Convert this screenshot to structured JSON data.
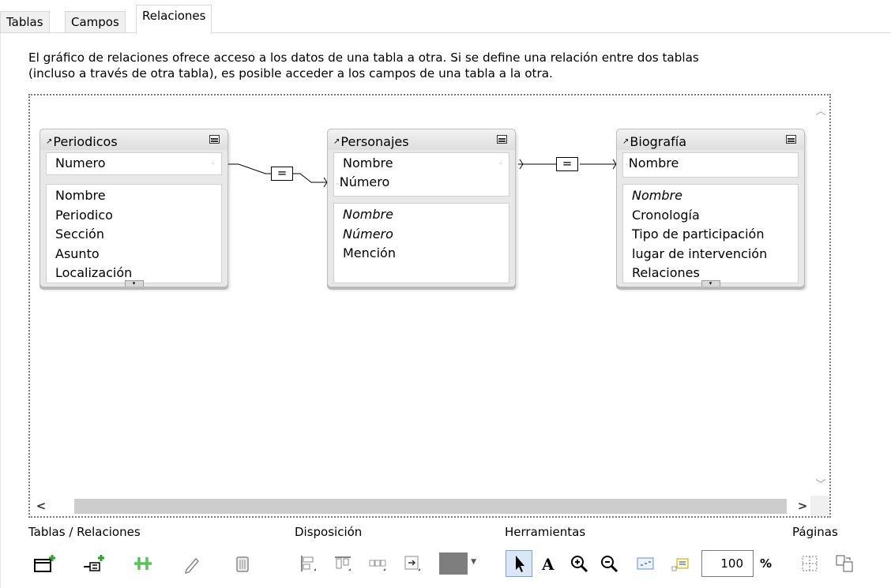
{
  "tabs": [
    {
      "label": "Tablas"
    },
    {
      "label": "Campos"
    },
    {
      "label": "Relaciones"
    }
  ],
  "active_tab": "Relaciones",
  "description": {
    "line1": "El gráfico de relaciones ofrece acceso a los datos de una tabla a otra. Si se define una relación entre dos tablas",
    "line2": "(incluso a través de otra tabla), es posible acceder a los campos de una tabla a la otra."
  },
  "tables": [
    {
      "name": "Periodicos",
      "key_fields": [
        "Numero"
      ],
      "fields": [
        {
          "text": "Nombre",
          "italic": false
        },
        {
          "text": "Periodico",
          "italic": false
        },
        {
          "text": "Sección",
          "italic": false
        },
        {
          "text": "Asunto",
          "italic": false
        },
        {
          "text": "Localización",
          "italic": false
        }
      ]
    },
    {
      "name": "Personajes",
      "key_fields": [
        "Nombre",
        "Número"
      ],
      "fields": [
        {
          "text": "Nombre",
          "italic": true
        },
        {
          "text": "Número",
          "italic": true
        },
        {
          "text": "Mención",
          "italic": false
        }
      ]
    },
    {
      "name": "Biografía",
      "key_fields": [
        "Nombre"
      ],
      "fields": [
        {
          "text": "Nombre",
          "italic": true
        },
        {
          "text": "Cronología",
          "italic": false
        },
        {
          "text": "Tipo de participación",
          "italic": false
        },
        {
          "text": "lugar de intervención",
          "italic": false
        },
        {
          "text": "Relaciones",
          "italic": false
        }
      ]
    }
  ],
  "relationship_operator": "=",
  "toolbar": {
    "groups": {
      "tables_relations": "Tablas / Relaciones",
      "layout": "Disposición",
      "tools": "Herramientas",
      "pages": "Páginas"
    },
    "zoom_value": "100",
    "zoom_unit": "%",
    "accent_green": "#2aa52a",
    "table_color": "#7e7e7e"
  }
}
